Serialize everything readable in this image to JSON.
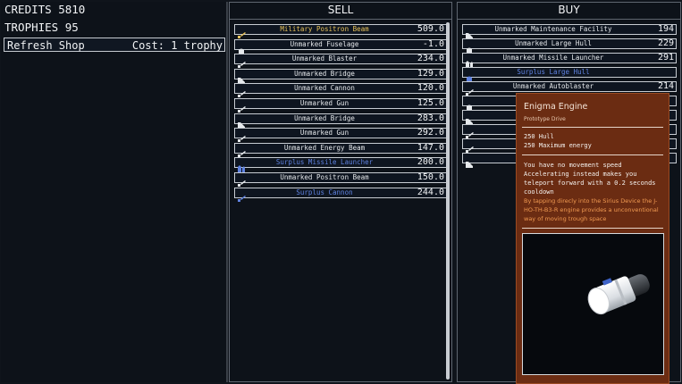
{
  "stats": {
    "credits": "CREDITS 5810",
    "trophies": "TROPHIES 95"
  },
  "refresh": {
    "label": "Refresh Shop",
    "cost": "Cost: 1 trophy"
  },
  "sell": {
    "header": "SELL",
    "items": [
      {
        "name": "Military Positron Beam",
        "price": "509.0",
        "color": "yellow",
        "icon": "gun-icon"
      },
      {
        "name": "Unmarked Fuselage",
        "price": "-1.0",
        "color": "white",
        "icon": "hull-icon"
      },
      {
        "name": "Unmarked Blaster",
        "price": "234.0",
        "color": "white",
        "icon": "gun-icon"
      },
      {
        "name": "Unmarked Bridge",
        "price": "129.0",
        "color": "white",
        "icon": "bridge-icon"
      },
      {
        "name": "Unmarked Cannon",
        "price": "120.0",
        "color": "white",
        "icon": "gun-icon"
      },
      {
        "name": "Unmarked Gun",
        "price": "125.0",
        "color": "white",
        "icon": "gun-icon"
      },
      {
        "name": "Unmarked Bridge",
        "price": "283.0",
        "color": "white",
        "icon": "bridge-icon"
      },
      {
        "name": "Unmarked Gun",
        "price": "292.0",
        "color": "white",
        "icon": "gun-icon"
      },
      {
        "name": "Unmarked Energy Beam",
        "price": "147.0",
        "color": "white",
        "icon": "gun-icon"
      },
      {
        "name": "Surplus Missile Launcher",
        "price": "200.0",
        "color": "blue",
        "icon": "launcher-icon"
      },
      {
        "name": "Unmarked Positron Beam",
        "price": "150.0",
        "color": "white",
        "icon": "gun-icon"
      },
      {
        "name": "Surplus Cannon",
        "price": "244.0",
        "color": "blue",
        "icon": "gun-icon"
      }
    ]
  },
  "buy": {
    "header": "BUY",
    "items": [
      {
        "name": "Unmarked Maintenance Facility",
        "price": "194",
        "color": "white",
        "icon": "bridge-icon"
      },
      {
        "name": "Unmarked Large Hull",
        "price": "229",
        "color": "white",
        "icon": "hull-icon"
      },
      {
        "name": "Unmarked Missile Launcher",
        "price": "291",
        "color": "white",
        "icon": "launcher-icon"
      },
      {
        "name": "Surplus Large Hull",
        "price": "",
        "color": "blue",
        "icon": "hull-icon"
      },
      {
        "name": "Unmarked Autoblaster",
        "price": "214",
        "color": "white",
        "icon": "gun-icon"
      },
      {
        "name": "",
        "price": "",
        "color": "white",
        "icon": "hull-icon"
      },
      {
        "name": "",
        "price": "",
        "color": "white",
        "icon": "bridge-icon"
      },
      {
        "name": "",
        "price": "",
        "color": "white",
        "icon": "gun-icon"
      },
      {
        "name": "",
        "price": "",
        "color": "white",
        "icon": "gun-icon"
      },
      {
        "name": "",
        "price": "",
        "color": "white",
        "icon": "bridge-icon"
      }
    ]
  },
  "tooltip": {
    "title": "Enigma Engine",
    "subtitle": "Prototype Drive",
    "stat1": "250 Hull",
    "stat2": "250 Maximum energy",
    "description": "You have no movement speed Accelerating instead makes you teleport forward with a 0.2 seconds cooldown",
    "lore": "By tapping direcly into the Sirius Device the J-HO-TH-B3-R engine provides a unconventional way of moving trough space"
  },
  "colors": {
    "yellow": "#e8c25a",
    "blue": "#5f82e0",
    "white": "#e6e9ec",
    "tooltip_bg": "#6b2c12"
  }
}
